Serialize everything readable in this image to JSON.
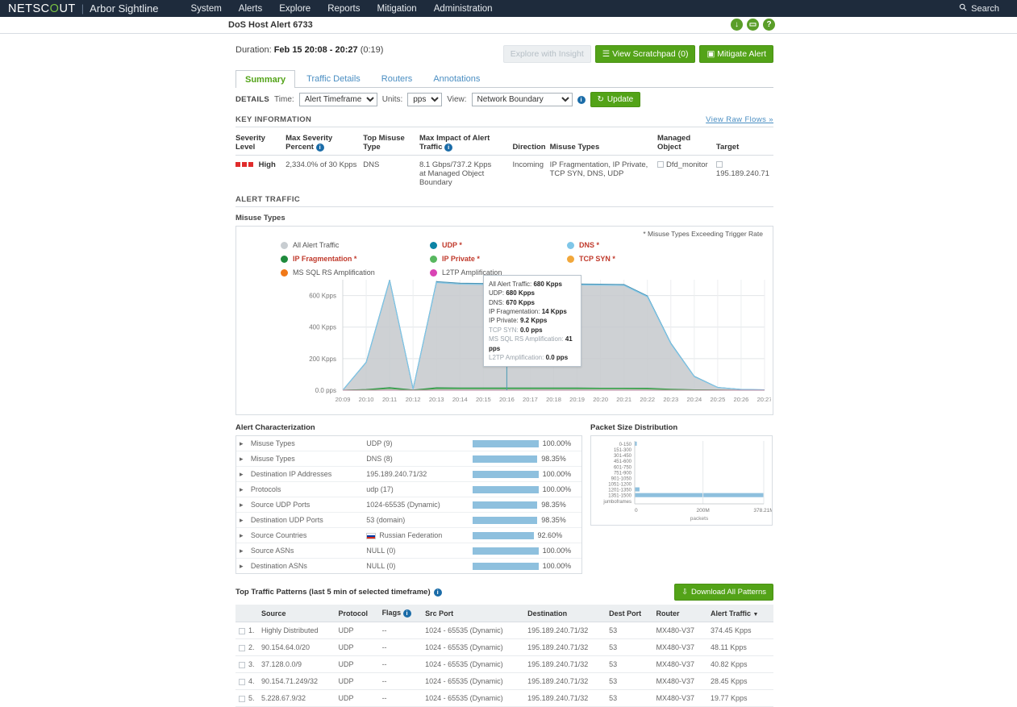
{
  "topnav": {
    "brand_pre": "NETSC",
    "brand_o": "O",
    "brand_post": "UT",
    "separator": "|",
    "product": "Arbor Sightline",
    "links": [
      "System",
      "Alerts",
      "Explore",
      "Reports",
      "Mitigation",
      "Administration"
    ],
    "search_label": "Search",
    "search_icon": "search-icon"
  },
  "subheader": {
    "title": "DoS Host Alert 6733",
    "icons": [
      {
        "name": "download-circle-icon",
        "glyph": "↓"
      },
      {
        "name": "comment-circle-icon",
        "glyph": "▭"
      },
      {
        "name": "help-circle-icon",
        "glyph": "?"
      }
    ]
  },
  "alert": {
    "duration_label": "Duration:",
    "duration_value": "Feb 15 20:08 - 20:27",
    "duration_suffix": "(0:19)",
    "buttons": {
      "explore_insight": "Explore with Insight",
      "scratchpad": "View Scratchpad (0)",
      "mitigate": "Mitigate Alert"
    }
  },
  "tabs": [
    {
      "label": "Summary",
      "active": true
    },
    {
      "label": "Traffic Details",
      "active": false
    },
    {
      "label": "Routers",
      "active": false
    },
    {
      "label": "Annotations",
      "active": false
    }
  ],
  "details": {
    "caption": "DETAILS",
    "time_label": "Time:",
    "time_value": "Alert Timeframe",
    "units_label": "Units:",
    "units_value": "pps",
    "view_label": "View:",
    "view_value": "Network Boundary",
    "update_label": "Update",
    "update_icon": "refresh-icon"
  },
  "key_information": {
    "section_title": "KEY INFORMATION",
    "view_raw_flows": "View Raw Flows »",
    "columns": [
      "Severity Level",
      "Max Severity Percent",
      "Top Misuse Type",
      "Max Impact of Alert Traffic",
      "Direction",
      "Misuse Types",
      "Managed Object",
      "Target"
    ],
    "row": {
      "severity": "High",
      "max_severity_percent": "2,334.0% of 30 Kpps",
      "top_misuse_type": "DNS",
      "max_impact": "8.1 Gbps/737.2 Kpps",
      "max_impact_sub": "at Managed Object Boundary",
      "direction": "Incoming",
      "misuse_types": "IP Fragmentation, IP Private, TCP SYN, DNS, UDP",
      "managed_object": "Dfd_monitor",
      "target": "195.189.240.71"
    }
  },
  "alert_traffic": {
    "section_title": "ALERT TRAFFIC",
    "sub_label": "Misuse Types",
    "trigger_note": "* Misuse Types Exceeding Trigger Rate",
    "legend": [
      {
        "label": "All Alert Traffic",
        "color": "#c8cdd1",
        "highlight": false
      },
      {
        "label": "UDP *",
        "color": "#0b84a5",
        "highlight": true
      },
      {
        "label": "DNS *",
        "color": "#7fc6e8",
        "highlight": true
      },
      {
        "label": "IP Fragmentation *",
        "color": "#1e8a3c",
        "highlight": true
      },
      {
        "label": "IP Private *",
        "color": "#57b75f",
        "highlight": true
      },
      {
        "label": "TCP SYN *",
        "color": "#f1a73b",
        "highlight": true
      },
      {
        "label": "MS SQL RS Amplification",
        "color": "#f07818",
        "highlight": false
      },
      {
        "label": "L2TP Amplification",
        "color": "#d944b4",
        "highlight": false
      }
    ],
    "tooltip": [
      {
        "label": "All Alert Traffic:",
        "value": "680 Kpps",
        "dim": false
      },
      {
        "label": "UDP:",
        "value": "680 Kpps",
        "dim": false
      },
      {
        "label": "DNS:",
        "value": "670 Kpps",
        "dim": false
      },
      {
        "label": "IP Fragmentation:",
        "value": "14 Kpps",
        "dim": false
      },
      {
        "label": "IP Private:",
        "value": "9.2 Kpps",
        "dim": false
      },
      {
        "label": "TCP SYN:",
        "value": "0.0 pps",
        "dim": true
      },
      {
        "label": "MS SQL RS Amplification:",
        "value": "41 pps",
        "dim": true
      },
      {
        "label": "L2TP Amplification:",
        "value": "0.0 pps",
        "dim": true
      }
    ]
  },
  "chart_data": [
    {
      "type": "area",
      "title": "Misuse Types",
      "xlabel": "",
      "ylabel": "pps",
      "ylim": [
        0,
        700
      ],
      "ytick_labels": [
        "600 Kpps",
        "400 Kpps",
        "200 Kpps",
        "0.0 pps"
      ],
      "yticks": [
        600,
        400,
        200,
        0
      ],
      "grid": true,
      "x": [
        "20:09",
        "20:10",
        "20:11",
        "20:12",
        "20:13",
        "20:14",
        "20:15",
        "20:16",
        "20:17",
        "20:18",
        "20:19",
        "20:20",
        "20:21",
        "20:22",
        "20:23",
        "20:24",
        "20:25",
        "20:26",
        "20:27"
      ],
      "cursor_x": "20:16",
      "series": [
        {
          "name": "All Alert Traffic",
          "color": "#c8cdd1",
          "values": [
            0,
            180,
            700,
            10,
            690,
            680,
            678,
            680,
            678,
            676,
            675,
            674,
            672,
            600,
            300,
            90,
            20,
            6,
            2
          ]
        },
        {
          "name": "UDP",
          "color": "#4a94b5",
          "values": [
            0,
            178,
            698,
            8,
            688,
            678,
            676,
            680,
            676,
            674,
            673,
            672,
            670,
            598,
            298,
            88,
            18,
            5,
            2
          ]
        },
        {
          "name": "DNS",
          "color": "#7fc6e8",
          "values": [
            0,
            176,
            694,
            7,
            682,
            672,
            670,
            670,
            670,
            668,
            667,
            666,
            664,
            592,
            294,
            86,
            17,
            5,
            2
          ]
        },
        {
          "name": "IP Fragmentation",
          "color": "#1e8a3c",
          "values": [
            0,
            4,
            16,
            1,
            15,
            14,
            14,
            14,
            14,
            14,
            14,
            13,
            13,
            12,
            6,
            2,
            1,
            0,
            0
          ]
        },
        {
          "name": "IP Private",
          "color": "#57b75f",
          "values": [
            0,
            2,
            10,
            0,
            9,
            9,
            9,
            9.2,
            9,
            9,
            9,
            9,
            9,
            8,
            4,
            1,
            0,
            0,
            0
          ]
        },
        {
          "name": "TCP SYN",
          "color": "#f1a73b",
          "values": [
            0,
            0,
            0,
            0,
            0,
            0,
            0,
            0,
            0,
            0,
            0,
            0,
            0,
            0,
            0,
            0,
            0,
            0,
            0
          ]
        },
        {
          "name": "MS SQL RS Amplification",
          "color": "#f07818",
          "values": [
            0,
            0,
            0.1,
            0,
            0.05,
            0.04,
            0.04,
            0.041,
            0.04,
            0.04,
            0.04,
            0.04,
            0.04,
            0.03,
            0.02,
            0,
            0,
            0,
            0
          ]
        },
        {
          "name": "L2TP Amplification",
          "color": "#d944b4",
          "values": [
            0,
            0,
            0,
            0,
            0,
            0,
            0,
            0,
            0,
            0,
            0,
            0,
            0,
            0,
            0,
            0,
            0,
            0,
            0
          ]
        }
      ]
    },
    {
      "type": "bar",
      "orientation": "horizontal",
      "title": "Packet Size Distribution",
      "xlabel": "packets",
      "ylabel": "",
      "categories": [
        "0-150",
        "151-300",
        "301-450",
        "451-600",
        "601-750",
        "751-900",
        "901-1050",
        "1051-1200",
        "1201-1350",
        "1351-1500",
        "jumboframes"
      ],
      "values": [
        6000000,
        0,
        0,
        0,
        0,
        0,
        0,
        0,
        14000000,
        378210000,
        0
      ],
      "xtick_labels": [
        "0",
        "200M",
        "378.21M"
      ],
      "xticks": [
        0,
        200000000,
        378210000
      ],
      "xlim": [
        0,
        378210000
      ],
      "bar_color": "#8ec0de"
    }
  ],
  "alert_characterization": {
    "title": "Alert Characterization",
    "rows": [
      {
        "key": "Misuse Types",
        "value": "UDP (9)",
        "pct": "100.00%",
        "width": 100
      },
      {
        "key": "Misuse Types",
        "value": "DNS (8)",
        "pct": "98.35%",
        "width": 98.35
      },
      {
        "key": "Destination IP Addresses",
        "value": "195.189.240.71/32",
        "pct": "100.00%",
        "width": 100
      },
      {
        "key": "Protocols",
        "value": "udp (17)",
        "pct": "100.00%",
        "width": 100
      },
      {
        "key": "Source UDP Ports",
        "value": "1024-65535 (Dynamic)",
        "pct": "98.35%",
        "width": 98.35
      },
      {
        "key": "Destination UDP Ports",
        "value": "53 (domain)",
        "pct": "98.35%",
        "width": 98.35
      },
      {
        "key": "Source Countries",
        "value": "Russian Federation",
        "pct": "92.60%",
        "width": 92.6,
        "flag": "flag-russia-icon"
      },
      {
        "key": "Source ASNs",
        "value": "NULL (0)",
        "pct": "100.00%",
        "width": 100
      },
      {
        "key": "Destination ASNs",
        "value": "NULL (0)",
        "pct": "100.00%",
        "width": 100
      }
    ]
  },
  "packet_size": {
    "title": "Packet Size Distribution",
    "axis_label": "packets"
  },
  "top_traffic": {
    "title": "Top Traffic Patterns (last 5 min of selected timeframe)",
    "download_label": "Download All Patterns",
    "download_icon": "download-icon",
    "columns": [
      "Source",
      "Protocol",
      "Flags",
      "Src Port",
      "Destination",
      "Dest Port",
      "Router",
      "Alert Traffic"
    ],
    "sort_column": "Alert Traffic",
    "rows": [
      {
        "num": "1.",
        "source": "Highly Distributed",
        "protocol": "UDP",
        "flags": "--",
        "src_port": "1024 - 65535 (Dynamic)",
        "destination": "195.189.240.71/32",
        "dest_port": "53",
        "router": "MX480-V37",
        "alert_traffic": "374.45 Kpps"
      },
      {
        "num": "2.",
        "source": "90.154.64.0/20",
        "protocol": "UDP",
        "flags": "--",
        "src_port": "1024 - 65535 (Dynamic)",
        "destination": "195.189.240.71/32",
        "dest_port": "53",
        "router": "MX480-V37",
        "alert_traffic": "48.11 Kpps"
      },
      {
        "num": "3.",
        "source": "37.128.0.0/9",
        "protocol": "UDP",
        "flags": "--",
        "src_port": "1024 - 65535 (Dynamic)",
        "destination": "195.189.240.71/32",
        "dest_port": "53",
        "router": "MX480-V37",
        "alert_traffic": "40.82 Kpps"
      },
      {
        "num": "4.",
        "source": "90.154.71.249/32",
        "protocol": "UDP",
        "flags": "--",
        "src_port": "1024 - 65535 (Dynamic)",
        "destination": "195.189.240.71/32",
        "dest_port": "53",
        "router": "MX480-V37",
        "alert_traffic": "28.45 Kpps"
      },
      {
        "num": "5.",
        "source": "5.228.67.9/32",
        "protocol": "UDP",
        "flags": "--",
        "src_port": "1024 - 65535 (Dynamic)",
        "destination": "195.189.240.71/32",
        "dest_port": "53",
        "router": "MX480-V37",
        "alert_traffic": "19.77 Kpps"
      }
    ]
  }
}
